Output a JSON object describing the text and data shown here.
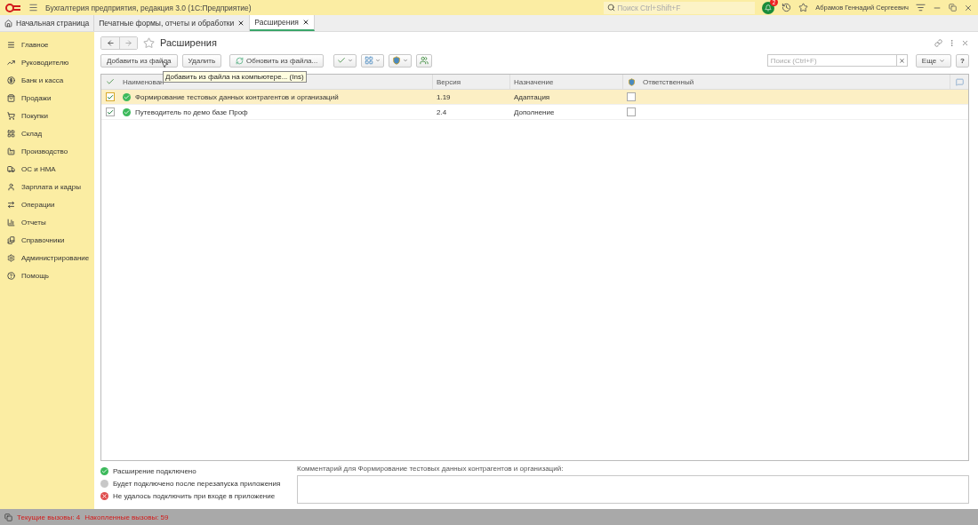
{
  "window": {
    "title": "Бухгалтерия предприятия, редакция 3.0  (1С:Предприятие)",
    "search_placeholder": "Поиск Ctrl+Shift+F",
    "notifications": "2",
    "user": "Абрамов Геннадий Сергеевич"
  },
  "tabs": [
    {
      "label": "Начальная страница",
      "kind": "home",
      "selected": false
    },
    {
      "label": "Печатные формы, отчеты и обработки",
      "kind": "closable",
      "selected": false
    },
    {
      "label": "Расширения",
      "kind": "closable",
      "selected": true
    }
  ],
  "sidebar": {
    "items": [
      {
        "label": "Главное"
      },
      {
        "label": "Руководителю"
      },
      {
        "label": "Банк и касса"
      },
      {
        "label": "Продажи"
      },
      {
        "label": "Покупки"
      },
      {
        "label": "Склад"
      },
      {
        "label": "Производство"
      },
      {
        "label": "ОС и НМА"
      },
      {
        "label": "Зарплата и кадры"
      },
      {
        "label": "Операции"
      },
      {
        "label": "Отчеты"
      },
      {
        "label": "Справочники"
      },
      {
        "label": "Администрирование"
      },
      {
        "label": "Помощь"
      }
    ]
  },
  "form": {
    "title": "Расширения",
    "favorite": false,
    "buttons": [
      "Добавить из файла",
      "Удалить",
      "Обновить из файла..."
    ],
    "search_placeholder": "Поиск (Ctrl+F)",
    "more": "Еще",
    "help": "?",
    "tooltip": "Добавить из файла на компьютере... (Ins)",
    "table": {
      "columns": [
        "Наименован",
        "Версия",
        "Назначение",
        "Ответственный"
      ],
      "rows": [
        {
          "active": true,
          "connected": true,
          "name": "Формирование тестовых данных контрагентов и организаций",
          "version": "1.19",
          "purpose": "Адаптация",
          "safe_mode": false,
          "selected": true
        },
        {
          "active": true,
          "connected": true,
          "name": "Путеводитель по демо базе Проф",
          "version": "2.4",
          "purpose": "Дополнение",
          "safe_mode": false,
          "selected": false
        }
      ]
    },
    "legend": [
      {
        "kind": "on",
        "label": "Расширение подключено"
      },
      {
        "kind": "pending",
        "label": "Будет подключено после перезапуска приложения"
      },
      {
        "kind": "error",
        "label": "Не удалось подключить при входе в приложение"
      }
    ],
    "comment_label": "Комментарий для Формирование тестовых данных контрагентов и организаций:"
  },
  "status_bar": {
    "current": "Текущие вызовы: 4",
    "accumulated": "Накопленные вызовы: 59"
  }
}
